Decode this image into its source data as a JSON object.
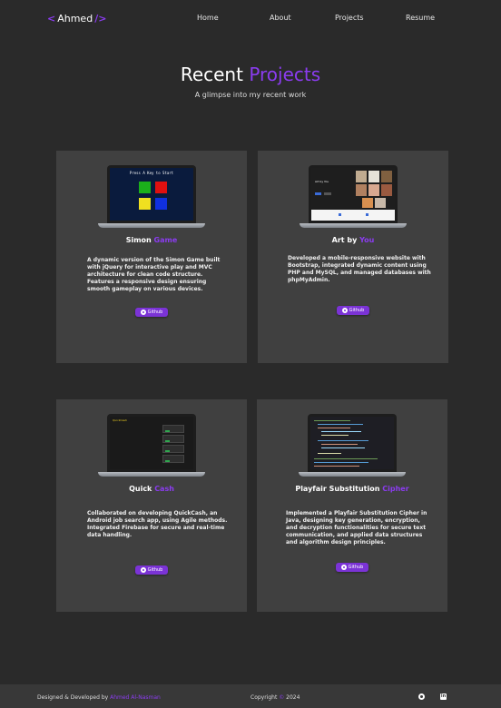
{
  "nav": {
    "logo_open": "<",
    "logo_name": "Ahmed",
    "logo_close": "/>",
    "links": [
      "Home",
      "About",
      "Projects",
      "Resume"
    ]
  },
  "hero": {
    "title_plain": "Recent",
    "title_accent": "Projects",
    "subtitle": "A glimpse into my recent work"
  },
  "projects": [
    {
      "title_plain": "Simon",
      "title_accent": "Game",
      "description": "A dynamic version of the Simon Game built with jQuery for interactive play and MVC architecture for clean code structure. Features a responsive design ensuring smooth gameplay on various devices.",
      "button": "Github",
      "screen_text": "Press A Key to Start"
    },
    {
      "title_plain": "Art by",
      "title_accent": "You",
      "description": "Developed a mobile-responsive website with Bootstrap, integrated dynamic content using PHP and MySQL, and managed databases with phpMyAdmin.",
      "button": "Github",
      "screen_text": "Art by You"
    },
    {
      "title_plain": "Quick",
      "title_accent": "Cash",
      "description": "Collaborated on developing QuickCash, an Android job search app, using Agile methods. Integrated Firebase for secure and real-time data handling.",
      "button": "Github",
      "screen_text": "QuickCash"
    },
    {
      "title_plain": "Playfair Substitution",
      "title_accent": "Cipher",
      "description": "Implemented a Playfair Substitution Cipher in Java, designing key generation, encryption, and decryption functionalities for secure text communication, and applied data structures and algorithm design principles.",
      "button": "Github",
      "screen_text": ""
    }
  ],
  "footer": {
    "designed_by": "Designed & Developed by",
    "author": "Ahmed Al-Nasman",
    "copyright": "Copyright",
    "copyright_symbol": "©",
    "year": "2024",
    "linkedin_glyph": "in"
  },
  "colors": {
    "accent": "#8b3cf0",
    "background": "#2a2a2a",
    "card": "#404040",
    "button": "#7b33d6"
  }
}
